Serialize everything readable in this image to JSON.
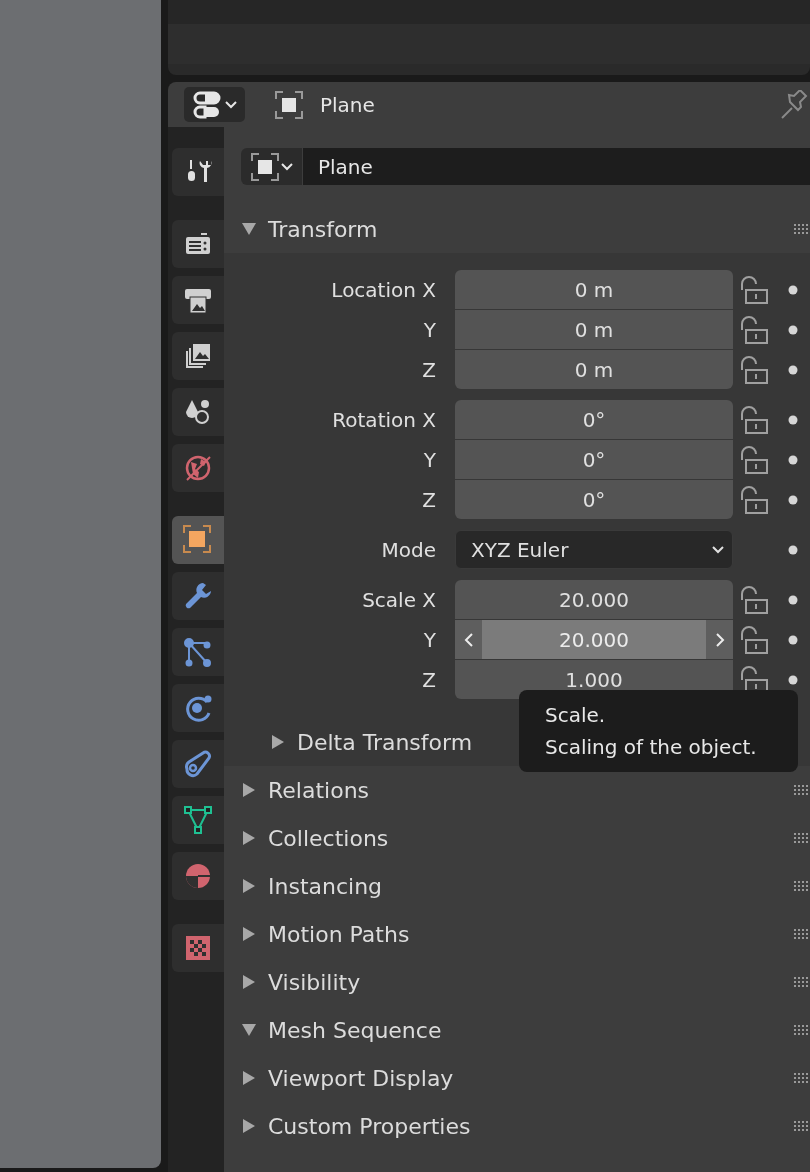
{
  "header": {
    "object_name": "Plane"
  },
  "tab_groups": [
    {
      "tabs": [
        {
          "kind": "tool",
          "selected": false
        }
      ]
    },
    {
      "tabs": [
        {
          "kind": "render",
          "selected": false
        },
        {
          "kind": "output",
          "selected": false
        },
        {
          "kind": "view_layer",
          "selected": false
        },
        {
          "kind": "scene",
          "selected": false
        },
        {
          "kind": "world",
          "selected": false
        }
      ]
    },
    {
      "tabs": [
        {
          "kind": "object",
          "selected": true
        },
        {
          "kind": "modifiers",
          "selected": false
        },
        {
          "kind": "particles",
          "selected": false
        },
        {
          "kind": "physics",
          "selected": false
        },
        {
          "kind": "constraints",
          "selected": false
        },
        {
          "kind": "data",
          "selected": false
        },
        {
          "kind": "material",
          "selected": false
        }
      ]
    },
    {
      "tabs": [
        {
          "kind": "texture",
          "selected": false
        }
      ]
    }
  ],
  "object_field": {
    "value": "Plane"
  },
  "panels": [
    {
      "title": "Transform",
      "expanded": true,
      "groups": [
        {
          "rows": [
            {
              "kind": "number",
              "label": "Location X",
              "value": "0 m",
              "locked": false,
              "hovered": false
            },
            {
              "kind": "number",
              "label": "Y",
              "value": "0 m",
              "locked": false,
              "hovered": false
            },
            {
              "kind": "number",
              "label": "Z",
              "value": "0 m",
              "locked": false,
              "hovered": false
            }
          ]
        },
        {
          "rows": [
            {
              "kind": "number",
              "label": "Rotation X",
              "value": "0°",
              "locked": false,
              "hovered": false
            },
            {
              "kind": "number",
              "label": "Y",
              "value": "0°",
              "locked": false,
              "hovered": false
            },
            {
              "kind": "number",
              "label": "Z",
              "value": "0°",
              "locked": false,
              "hovered": false
            }
          ]
        },
        {
          "rows": [
            {
              "kind": "dropdown",
              "label": "Mode",
              "value": "XYZ Euler"
            }
          ]
        },
        {
          "rows": [
            {
              "kind": "number",
              "label": "Scale X",
              "value": "20.000",
              "locked": false,
              "hovered": false
            },
            {
              "kind": "number",
              "label": "Y",
              "value": "20.000",
              "locked": false,
              "hovered": true
            },
            {
              "kind": "number",
              "label": "Z",
              "value": "1.000",
              "locked": false,
              "hovered": false
            }
          ]
        }
      ],
      "subpanels": [
        {
          "title": "Delta Transform",
          "expanded": false
        }
      ]
    },
    {
      "title": "Relations",
      "expanded": false
    },
    {
      "title": "Collections",
      "expanded": false
    },
    {
      "title": "Instancing",
      "expanded": false
    },
    {
      "title": "Motion Paths",
      "expanded": false
    },
    {
      "title": "Visibility",
      "expanded": false
    },
    {
      "title": "Mesh Sequence",
      "expanded": true
    },
    {
      "title": "Viewport Display",
      "expanded": false
    },
    {
      "title": "Custom Properties",
      "expanded": false
    }
  ],
  "tooltip": {
    "title": "Scale.",
    "description": "Scaling of the object."
  }
}
